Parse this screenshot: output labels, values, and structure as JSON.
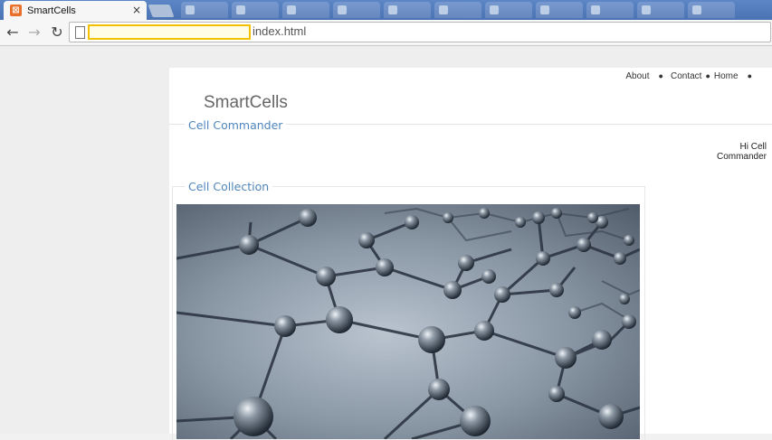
{
  "browser": {
    "tab_title": "SmartCells",
    "tab_close": "×",
    "favicon_glyph": "⊠",
    "url": "index.html",
    "back": "←",
    "forward": "→",
    "reload": "↻"
  },
  "header": {
    "site_title": "SmartCells",
    "nav": [
      {
        "label": "About"
      },
      {
        "label": "Contact"
      },
      {
        "label": "Home"
      }
    ],
    "nav_separator": "●"
  },
  "sections": {
    "commander_title": "Cell Commander",
    "greeting_line1": "Hi Cell",
    "greeting_line2": "Commander",
    "collection_title": "Cell Collection"
  },
  "colors": {
    "accent": "#4f86bd",
    "title": "#666666",
    "tabstrip": "#4a73b3"
  }
}
